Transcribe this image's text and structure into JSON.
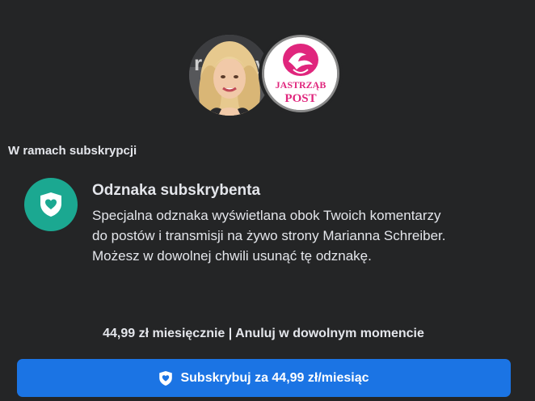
{
  "creators": {
    "person_avatar_alt": "Marianna Schreiber",
    "logo_line1": "JASTRZĄB",
    "logo_line2": "POST"
  },
  "section": {
    "title": "W ramach subskrypcji"
  },
  "feature": {
    "icon": "shield-heart-icon",
    "title": "Odznaka subskrybenta",
    "description_lines": [
      "Specjalna odznaka wyświetlana obok Twoich komentarzy",
      "do postów i transmisji na żywo strony Marianna Schreiber.",
      "Możesz w dowolnej chwili usunąć tę odznakę."
    ]
  },
  "price_note": "44,99 zł miesięcznie | Anuluj w dowolnym momencie",
  "subscribe_button": {
    "label": "Subskrybuj za 44,99 zł/miesiąc",
    "icon": "shield-heart-icon"
  },
  "colors": {
    "background": "#242526",
    "accent_blue": "#1b74e4",
    "badge_green": "#1ba891",
    "logo_pink": "#e0267d"
  }
}
